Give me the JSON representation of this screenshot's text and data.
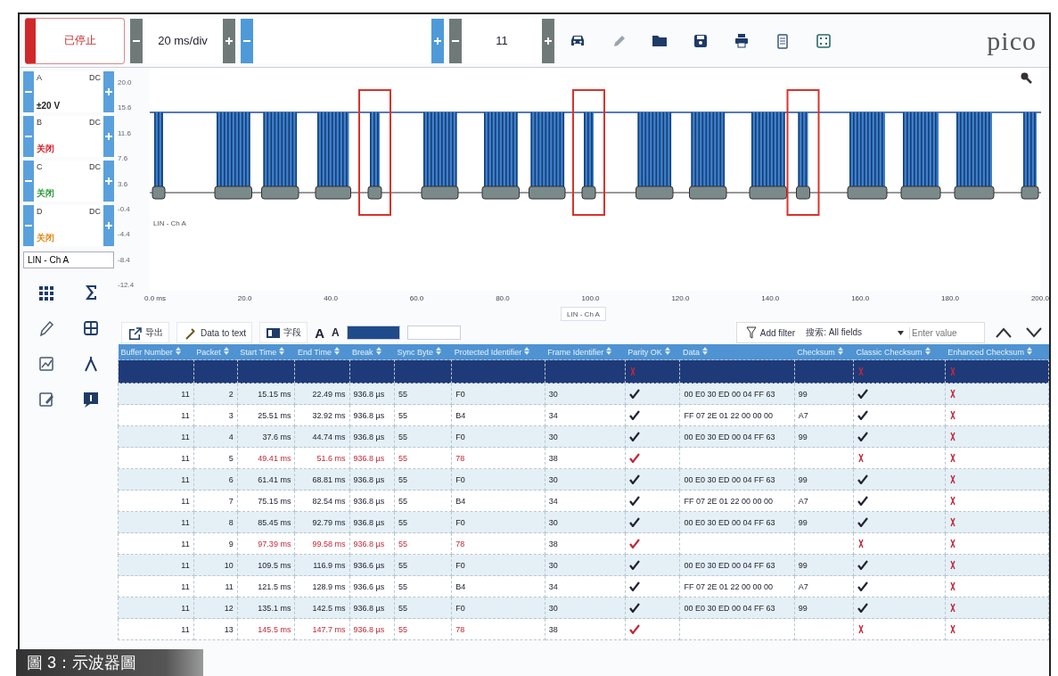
{
  "toolbar": {
    "run_button": {
      "label": "已停止",
      "running": false
    },
    "timebase": {
      "value": "20 ms/div"
    },
    "capture": {
      "value": "11"
    },
    "logo": "pico"
  },
  "channels": [
    {
      "name": "A",
      "coupling": "DC",
      "range": "±20 V",
      "color": "#222222"
    },
    {
      "name": "B",
      "coupling": "DC",
      "range": "关闭",
      "color": "#e0202a"
    },
    {
      "name": "C",
      "coupling": "DC",
      "range": "关闭",
      "color": "#2e9a3a"
    },
    {
      "name": "D",
      "coupling": "DC",
      "range": "关闭",
      "color": "#e08a1a"
    }
  ],
  "decoder_field": "LIN - Ch A",
  "plot": {
    "yticks": [
      "20.0",
      "15.6",
      "11.6",
      "7.6",
      "3.6",
      "-0.4",
      "-4.4",
      "-8.4",
      "-12.4"
    ],
    "trace_label": "LIN - Ch A",
    "xticks": [
      "0.0 ms",
      "20.0",
      "40.0",
      "60.0",
      "80.0",
      "100.0",
      "120.0",
      "140.0",
      "160.0",
      "180.0",
      "200.0"
    ],
    "axis_label": "LIN - Ch A"
  },
  "table_toolbar": {
    "buttons": [
      "导出",
      "Data to text",
      "字段"
    ],
    "font_buttons": [
      "A",
      "A"
    ],
    "filter": "Add filter",
    "search_scope": "搜索: All fields",
    "search_placeholder": "Enter value"
  },
  "table": {
    "columns": [
      "Buffer Number",
      "Packet",
      "Start Time",
      "End Time",
      "Break",
      "Sync Byte",
      "Protected Identifier",
      "Frame Identifier",
      "Parity OK",
      "Data",
      "Checksum",
      "Classic Checksum",
      "Enhanced Checksum"
    ],
    "rows": [
      {
        "selected": true,
        "error": true,
        "parity_ok": false,
        "classic_ok": false,
        "enhanced_ok": false
      },
      {
        "selected": false,
        "error": false,
        "cells": [
          "11",
          "2",
          "15.15 ms",
          "22.49 ms",
          "936.8 µs",
          "55",
          "F0",
          "30"
        ],
        "parity_ok": true,
        "data": "00 E0 30 ED 00 04 FF 63",
        "checksum": "99",
        "classic_ok": true,
        "enhanced_ok": false
      },
      {
        "selected": false,
        "error": false,
        "cells": [
          "11",
          "3",
          "25.51 ms",
          "32.92 ms",
          "936.8 µs",
          "55",
          "B4",
          "34"
        ],
        "parity_ok": true,
        "data": "FF 07 2E 01 22 00 00 00",
        "checksum": "A7",
        "classic_ok": true,
        "enhanced_ok": false
      },
      {
        "selected": false,
        "error": false,
        "cells": [
          "11",
          "4",
          "37.6 ms",
          "44.74 ms",
          "936.8 µs",
          "55",
          "F0",
          "30"
        ],
        "parity_ok": true,
        "data": "00 E0 30 ED 00 04 FF 63",
        "checksum": "99",
        "classic_ok": true,
        "enhanced_ok": false
      },
      {
        "selected": false,
        "error": true,
        "cells": [
          "11",
          "5",
          "49.41 ms",
          "51.6 ms",
          "936.8 µs",
          "55",
          "78",
          "38"
        ],
        "parity_ok": true,
        "classic_ok": false,
        "enhanced_ok": false
      },
      {
        "selected": false,
        "error": false,
        "cells": [
          "11",
          "6",
          "61.41 ms",
          "68.81 ms",
          "936.8 µs",
          "55",
          "F0",
          "30"
        ],
        "parity_ok": true,
        "data": "00 E0 30 ED 00 04 FF 63",
        "checksum": "99",
        "classic_ok": true,
        "enhanced_ok": false
      },
      {
        "selected": false,
        "error": false,
        "cells": [
          "11",
          "7",
          "75.15 ms",
          "82.54 ms",
          "936.8 µs",
          "55",
          "B4",
          "34"
        ],
        "parity_ok": true,
        "data": "FF 07 2E 01 22 00 00 00",
        "checksum": "A7",
        "classic_ok": true,
        "enhanced_ok": false
      },
      {
        "selected": false,
        "error": false,
        "cells": [
          "11",
          "8",
          "85.45 ms",
          "92.79 ms",
          "936.8 µs",
          "55",
          "F0",
          "30"
        ],
        "parity_ok": true,
        "data": "00 E0 30 ED 00 04 FF 63",
        "checksum": "99",
        "classic_ok": true,
        "enhanced_ok": false
      },
      {
        "selected": false,
        "error": true,
        "cells": [
          "11",
          "9",
          "97.39 ms",
          "99.58 ms",
          "936.8 µs",
          "55",
          "78",
          "38"
        ],
        "parity_ok": true,
        "classic_ok": false,
        "enhanced_ok": false
      },
      {
        "selected": false,
        "error": false,
        "cells": [
          "11",
          "10",
          "109.5 ms",
          "116.9 ms",
          "936.6 µs",
          "55",
          "F0",
          "30"
        ],
        "parity_ok": true,
        "data": "00 E0 30 ED 00 04 FF 63",
        "checksum": "99",
        "classic_ok": true,
        "enhanced_ok": false
      },
      {
        "selected": false,
        "error": false,
        "cells": [
          "11",
          "11",
          "121.5 ms",
          "128.9 ms",
          "936.6 µs",
          "55",
          "B4",
          "34"
        ],
        "parity_ok": true,
        "data": "FF 07 2E 01 22 00 00 00",
        "checksum": "A7",
        "classic_ok": true,
        "enhanced_ok": false
      },
      {
        "selected": false,
        "error": false,
        "cells": [
          "11",
          "12",
          "135.1 ms",
          "142.5 ms",
          "936.8 µs",
          "55",
          "F0",
          "30"
        ],
        "parity_ok": true,
        "data": "00 E0 30 ED 00 04 FF 63",
        "checksum": "99",
        "classic_ok": true,
        "enhanced_ok": false
      },
      {
        "selected": false,
        "error": true,
        "cells": [
          "11",
          "13",
          "145.5 ms",
          "147.7 ms",
          "936.8 µs",
          "55",
          "78",
          "38"
        ],
        "parity_ok": true,
        "classic_ok": false,
        "enhanced_ok": false
      }
    ]
  },
  "caption": "圖 3：示波器圖"
}
